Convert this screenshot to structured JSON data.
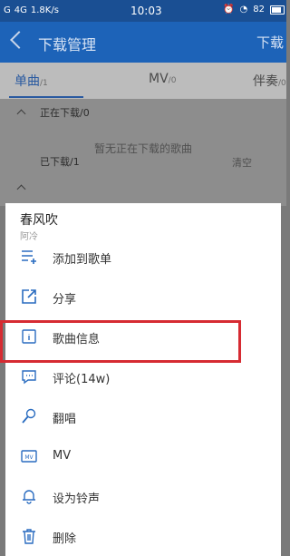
{
  "status": {
    "signal_left": "G",
    "network": "4G",
    "speed": "1.8K/s",
    "time": "10:03",
    "battery": "82"
  },
  "appbar": {
    "title": "下载管理",
    "right_action": "下载"
  },
  "tabs": [
    {
      "label": "单曲",
      "count": "/1"
    },
    {
      "label": "MV",
      "count": "/0"
    },
    {
      "label": "伴奏",
      "count": "/0"
    }
  ],
  "downloading": {
    "label": "正在下载/0",
    "empty_message": "暂无正在下载的歌曲"
  },
  "downloaded": {
    "label": "已下载/1",
    "clear": "清空"
  },
  "sheet": {
    "song_title": "春风吹",
    "artist": "阿冷",
    "items": [
      {
        "label": "添加到歌单",
        "icon": "add-to-playlist-icon"
      },
      {
        "label": "分享",
        "icon": "share-icon"
      },
      {
        "label": "歌曲信息",
        "icon": "info-icon"
      },
      {
        "label": "评论(14w)",
        "icon": "comment-icon"
      },
      {
        "label": "翻唱",
        "icon": "microphone-icon"
      },
      {
        "label": "MV",
        "icon": "mv-icon"
      },
      {
        "label": "设为铃声",
        "icon": "bell-icon"
      },
      {
        "label": "删除",
        "icon": "trash-icon"
      }
    ]
  },
  "colors": {
    "accent": "#1d63b8",
    "highlight": "#d62b32"
  }
}
